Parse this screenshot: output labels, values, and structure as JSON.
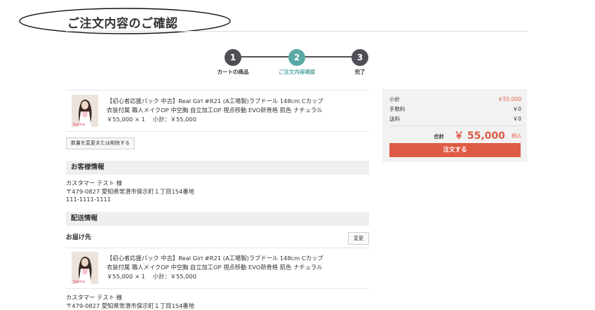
{
  "page": {
    "title": "ご注文内容のご確認"
  },
  "steps": [
    {
      "number": "1",
      "label": "カートの商品"
    },
    {
      "number": "2",
      "label": "ご注文内容確認"
    },
    {
      "number": "3",
      "label": "完了"
    }
  ],
  "current_step": 2,
  "product": {
    "line1": "【初心者応援パック 中古】Real Girl #R21 (A工場製)ラブドール 148cm Cカップ",
    "line2": "衣装付属 職人メイクOP 中空胸 自立加工OP 視点移動 EVO新骨格 肌色 ナチュラル",
    "price_line": "￥55,000 × 1　 小計：￥55,000"
  },
  "cart": {
    "edit_button": "数量を変更または削除する"
  },
  "customer": {
    "heading": "お客様情報",
    "name": "カスタマー テスト 様",
    "address": "〒479-0827 愛知県常滑市保示町１丁目154番地",
    "phone": "111-1111-1111"
  },
  "shipping": {
    "heading": "配送情報",
    "destination_label": "お届け先",
    "change_button": "変更",
    "name": "カスタマー テスト 様",
    "address": "〒479-0827 愛知県常滑市保示町１丁目154番地"
  },
  "summary": {
    "subtotal_label": "小計",
    "subtotal_value": "￥55,000",
    "fee_label": "手数料",
    "fee_value": "￥0",
    "shipping_label": "送料",
    "shipping_value": "￥0",
    "total_label": "合計",
    "total_value": "￥ 55,000",
    "tax_note": "税込",
    "order_button": "注文する"
  },
  "colors": {
    "accent_red": "#de5b45",
    "step_active": "#5aa9a5",
    "step_inactive": "#524e58"
  }
}
